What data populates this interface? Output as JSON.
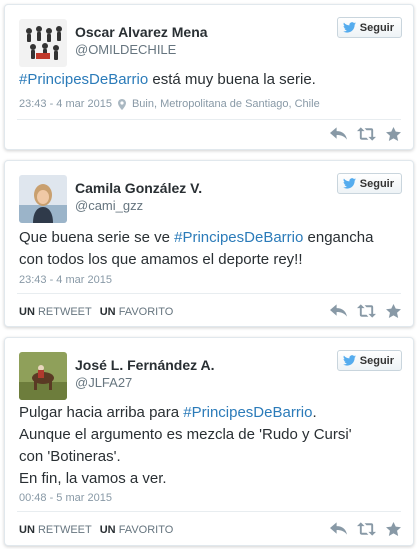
{
  "tweets": [
    {
      "name": "Oscar Alvarez Mena",
      "handle": "@OMILDECHILE",
      "follow_label": "Seguir",
      "hashtag": "#PrincipesDeBarrio",
      "text_after": " está muy buena la serie.",
      "time": "23:43 - 4 mar 2015",
      "location": "Buin, Metropolitana de Santiago, Chile"
    },
    {
      "name": "Camila González V.",
      "handle": "@cami_gzz",
      "follow_label": "Seguir",
      "line1_before": "Que buena serie se ve ",
      "hashtag": "#PrincipesDeBarrio",
      "line1_after": " engancha",
      "line2": "con todos los que amamos el deporte rey!!",
      "time": "23:43 - 4 mar 2015",
      "retweet_count": "UN",
      "retweet_label": "RETWEET",
      "favorite_count": "UN",
      "favorite_label": "FAVORITO"
    },
    {
      "name": "José L. Fernández A.",
      "handle": "@JLFA27",
      "follow_label": "Seguir",
      "line1_before": "Pulgar hacia arriba para ",
      "hashtag": "#PrincipesDeBarrio",
      "line1_after": ".",
      "line2": "Aunque el argumento es mezcla de 'Rudo y Cursi'",
      "line3": "con 'Botineras'.",
      "line4": "En fin, la vamos a ver.",
      "time": "00:48 - 5 mar 2015",
      "retweet_count": "UN",
      "retweet_label": "RETWEET",
      "favorite_count": "UN",
      "favorite_label": "FAVORITO"
    }
  ],
  "icons": {
    "follow": "twitter-bird-icon",
    "location": "location-pin-icon",
    "reply": "reply-icon",
    "retweet": "retweet-icon",
    "favorite": "star-icon"
  },
  "colors": {
    "hashtag": "#2b7bb9",
    "twitter_blue": "#55acee",
    "action_gray": "#8899a6"
  }
}
